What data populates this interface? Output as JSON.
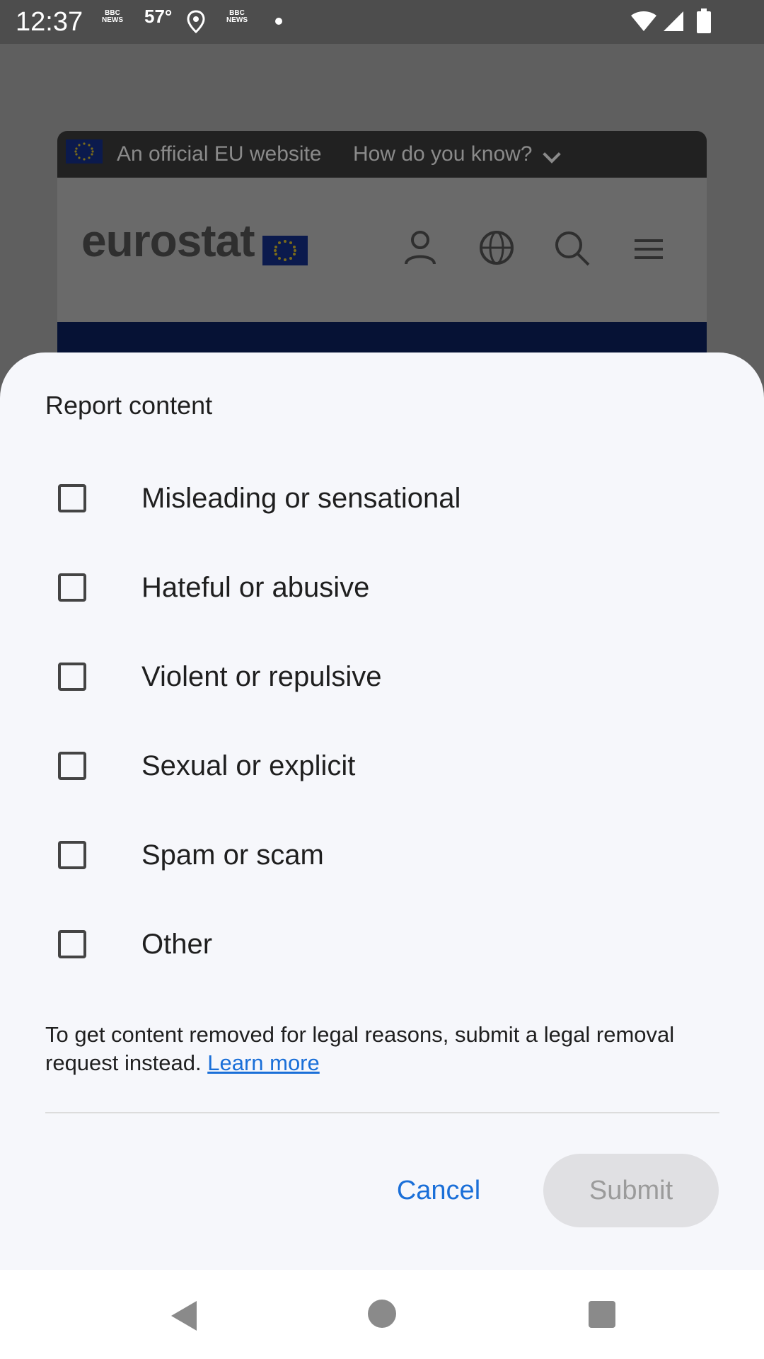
{
  "status_bar": {
    "time": "12:37",
    "news_icon_text": "BBC NEWS",
    "temperature": "57°"
  },
  "background_page": {
    "eu_banner_text": "An official EU website",
    "eu_banner_link": "How do you know?",
    "logo_text": "eurostat"
  },
  "sheet": {
    "title": "Report content",
    "options": [
      {
        "label": "Misleading or sensational",
        "checked": false
      },
      {
        "label": "Hateful or abusive",
        "checked": false
      },
      {
        "label": "Violent or repulsive",
        "checked": false
      },
      {
        "label": "Sexual or explicit",
        "checked": false
      },
      {
        "label": "Spam or scam",
        "checked": false
      },
      {
        "label": "Other",
        "checked": false
      }
    ],
    "legal_text": "To get content removed for legal reasons, submit a legal removal request instead.",
    "learn_more": "Learn more",
    "cancel_label": "Cancel",
    "submit_label": "Submit"
  },
  "colors": {
    "accent": "#1a6fd8",
    "sheet_bg": "#f6f7fb",
    "scrim": "#5f5f5f"
  }
}
